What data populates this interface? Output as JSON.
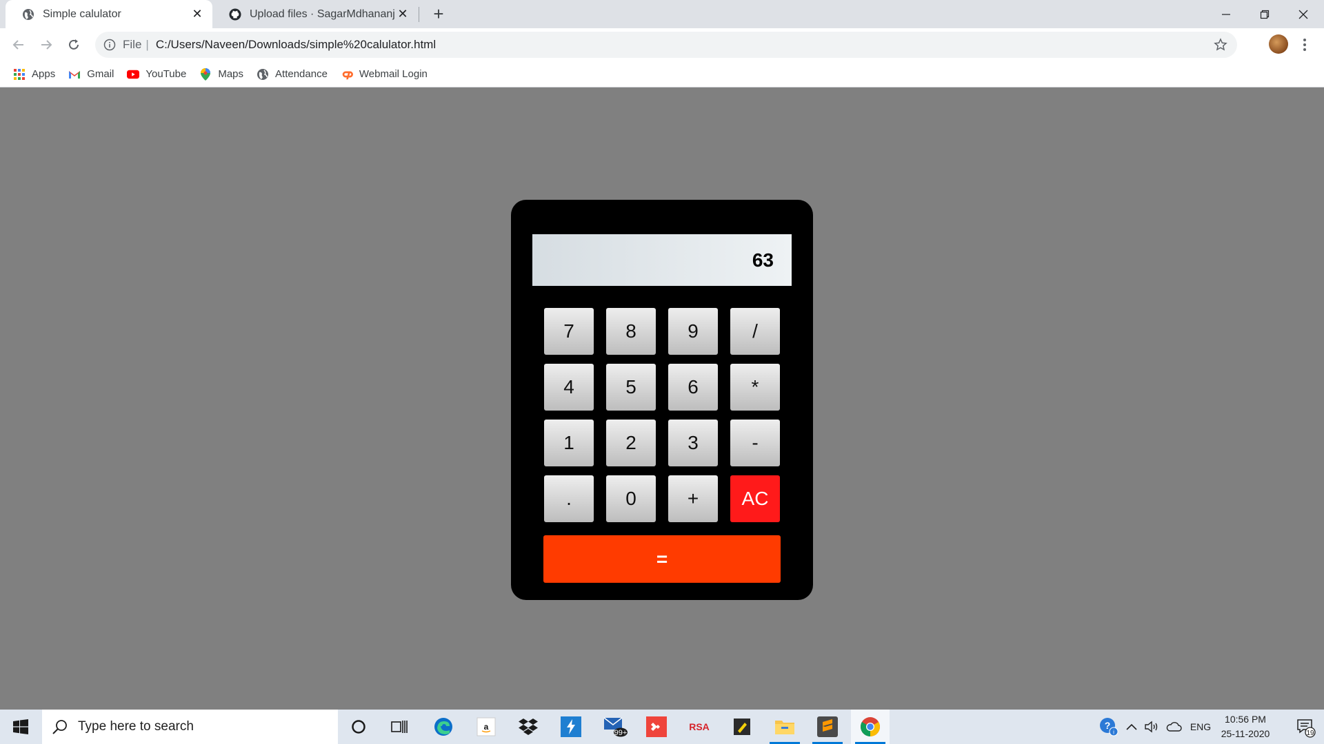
{
  "browser": {
    "tabs": [
      {
        "title": "Simple calulator",
        "active": true
      },
      {
        "title": "Upload files · SagarMdhananjay/...",
        "active": false
      }
    ],
    "address": {
      "scheme": "File",
      "url": "C:/Users/Naveen/Downloads/simple%20calulator.html"
    },
    "bookmarks": [
      {
        "label": "Apps",
        "icon": "apps-grid-icon"
      },
      {
        "label": "Gmail",
        "icon": "gmail-icon"
      },
      {
        "label": "YouTube",
        "icon": "youtube-icon"
      },
      {
        "label": "Maps",
        "icon": "maps-icon"
      },
      {
        "label": "Attendance",
        "icon": "globe-icon"
      },
      {
        "label": "Webmail Login",
        "icon": "cpanel-icon"
      }
    ]
  },
  "calculator": {
    "display": "63",
    "keys": {
      "k7": "7",
      "k8": "8",
      "k9": "9",
      "div": "/",
      "k4": "4",
      "k5": "5",
      "k6": "6",
      "mul": "*",
      "k1": "1",
      "k2": "2",
      "k3": "3",
      "sub": "-",
      "dot": ".",
      "k0": "0",
      "add": "+",
      "clear": "AC",
      "equals": "="
    },
    "colors": {
      "clear": "#ff1a1a",
      "equals": "#ff3b00",
      "body": "#000000",
      "page": "#808080"
    }
  },
  "taskbar": {
    "search_placeholder": "Type here to search",
    "mail_badge": "99+",
    "rsa_label": "RSA",
    "language": "ENG",
    "time": "10:56 PM",
    "date": "25-11-2020",
    "notification_count": "19"
  }
}
